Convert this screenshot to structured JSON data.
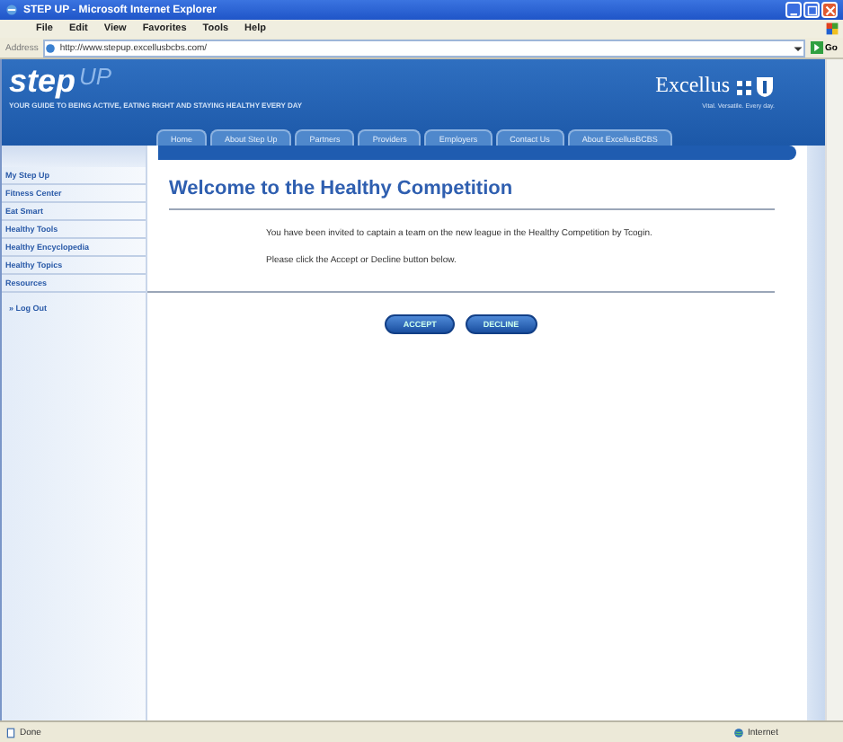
{
  "window": {
    "title": "STEP UP - Microsoft Internet Explorer"
  },
  "menu": [
    "File",
    "Edit",
    "View",
    "Favorites",
    "Tools",
    "Help"
  ],
  "address": {
    "label": "Address",
    "value": "http://www.stepup.excellusbcbs.com/",
    "go": "Go"
  },
  "header": {
    "logo_main": "step",
    "logo_accent": "UP",
    "tagline": "YOUR GUIDE TO BEING ACTIVE, EATING RIGHT AND STAYING HEALTHY EVERY DAY",
    "brand": "Excellus",
    "brand_tagline": "Vital. Versatile. Every day."
  },
  "nav": [
    {
      "label": "Home",
      "selected": false
    },
    {
      "label": "About Step Up",
      "selected": false
    },
    {
      "label": "Partners",
      "selected": false
    },
    {
      "label": "Providers",
      "selected": false
    },
    {
      "label": "Employers",
      "selected": false
    },
    {
      "label": "Contact Us",
      "selected": false
    },
    {
      "label": "About ExcellusBCBS",
      "selected": false
    }
  ],
  "sidebar": {
    "items": [
      "My Step Up",
      "Fitness Center",
      "Eat Smart",
      "Healthy Tools",
      "Healthy Encyclopedia",
      "Healthy Topics",
      "Resources"
    ],
    "logout": "» Log Out"
  },
  "content": {
    "heading": "Welcome to the Healthy Competition",
    "message": "You have been invited to captain a team on the new league in the Healthy Competition by Tcogin.",
    "instruction": "Please click the Accept or Decline button below.",
    "buttons": [
      "ACCEPT",
      "DECLINE"
    ]
  },
  "status_bar": {
    "status": "Done",
    "zone": "Internet"
  }
}
